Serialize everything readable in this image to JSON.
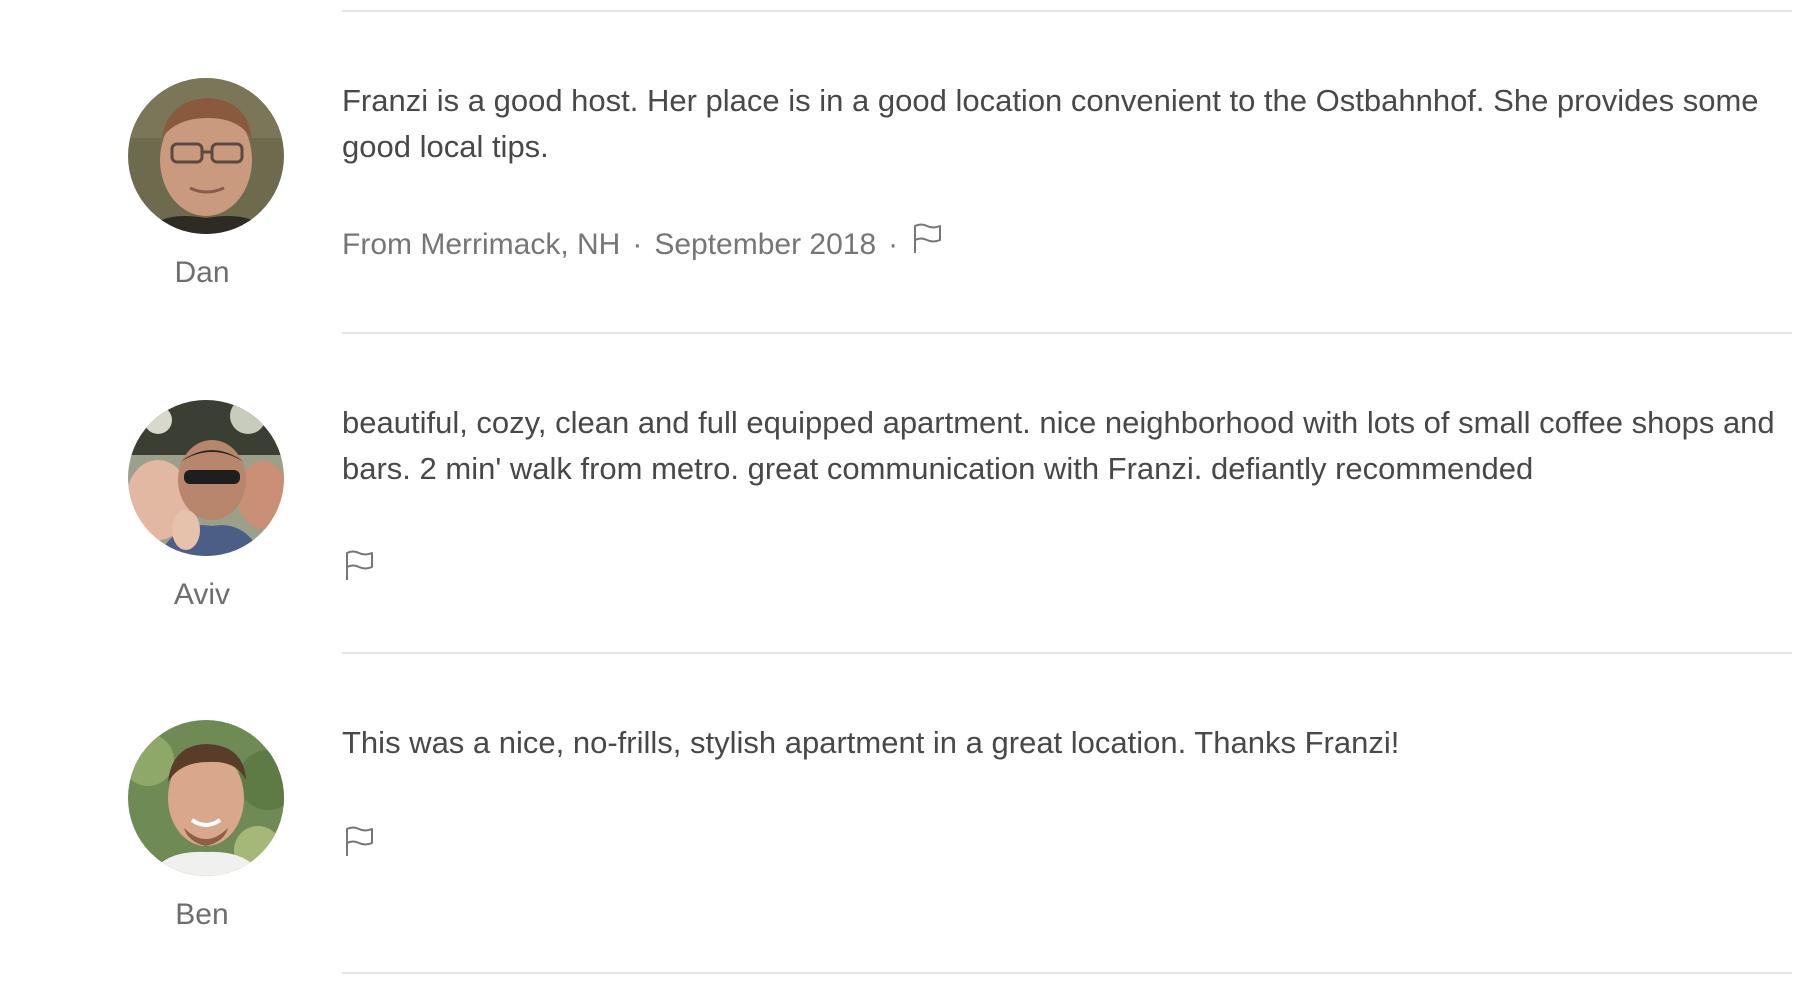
{
  "reviews": [
    {
      "name": "Dan",
      "text": "Franzi is a good host. Her place is in a good location convenient to the Ostbahnhof. She provides some good local tips.",
      "location": "From Merrimack, NH",
      "date": "September 2018",
      "meta_separator": "·",
      "flag_icon": "flag-icon"
    },
    {
      "name": "Aviv",
      "text": "beautiful, cozy, clean and full equipped apartment. nice neighborhood with lots of small coffee shops and bars. 2 min' walk from metro. great communication with Franzi. defiantly recommended",
      "flag_icon": "flag-icon"
    },
    {
      "name": "Ben",
      "text": "This was a nice, no-frills, stylish apartment in a great location. Thanks Franzi!",
      "flag_icon": "flag-icon"
    }
  ],
  "colors": {
    "text": "#484848",
    "muted": "#767676",
    "divider": "#e4e4e4"
  }
}
